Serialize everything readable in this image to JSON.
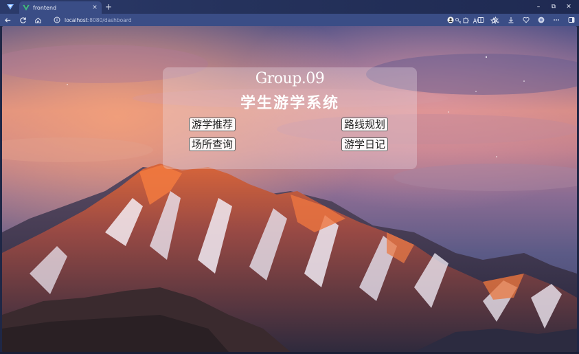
{
  "browser": {
    "tab_title": "frontend",
    "tab_close": "×",
    "new_tab": "+",
    "address_host": "localhost",
    "address_path": ":8080/dashboard",
    "window_minimize": "–",
    "window_maximize": "⧉",
    "window_close": "✕"
  },
  "dashboard": {
    "title": "Group.09",
    "subtitle": "学生游学系统",
    "buttons": [
      {
        "label": "游学推荐"
      },
      {
        "label": "路线规划"
      },
      {
        "label": "场所查询"
      },
      {
        "label": "游学日记"
      }
    ]
  },
  "colors": {
    "browser_chrome": "#3a4d86",
    "card_overlay": "rgba(235,225,232,0.32)",
    "button_bg": "#ffffff",
    "title_text": "#ffffff"
  },
  "icons": {
    "back": "arrow-left-icon",
    "refresh": "refresh-icon",
    "home": "home-icon",
    "info": "info-icon",
    "favorite": "star-icon",
    "downloads": "download-icon",
    "extensions": "puzzle-icon",
    "menu": "ellipsis-icon",
    "sidebar": "sidebar-icon"
  }
}
